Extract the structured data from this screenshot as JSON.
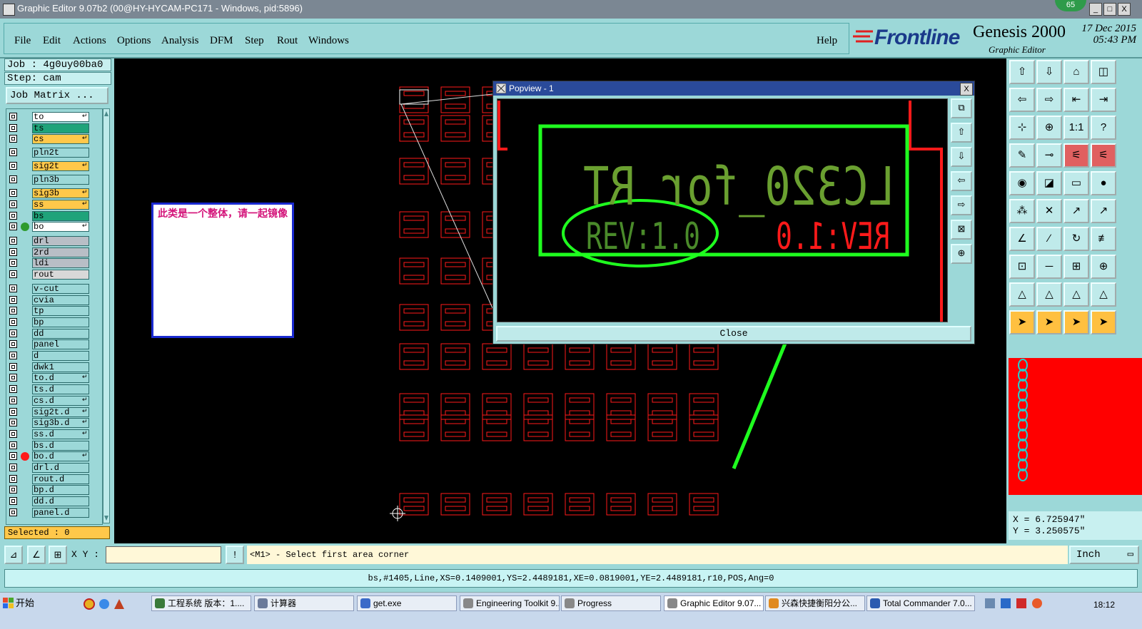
{
  "window": {
    "title": "Graphic Editor 9.07b2 (00@HY-HYCAM-PC171 - Windows, pid:5896)",
    "badge": "65",
    "minimize": "_",
    "maximize": "□",
    "close": "X"
  },
  "menu": {
    "items": [
      "File",
      "Edit",
      "Actions",
      "Options",
      "Analysis",
      "DFM",
      "Step",
      "Rout",
      "Windows"
    ],
    "help": "Help"
  },
  "brand": {
    "frontline": "Frontline",
    "product": "Genesis 2000",
    "subtitle": "Graphic Editor",
    "date": "17 Dec 2015",
    "time": "05:43 PM"
  },
  "job": {
    "job_label": "Job : 4g0uy00ba0",
    "step_label": "Step: cam",
    "job_matrix": "Job Matrix ...",
    "selected": "Selected : 0"
  },
  "layers": [
    {
      "name": "to",
      "color": "#ffffff",
      "flag": "↵"
    },
    {
      "name": "ts",
      "color": "#1fa37a",
      "flag": ""
    },
    {
      "name": "cs",
      "color": "#ffc84a",
      "flag": "↵"
    },
    {
      "name": "pln2t",
      "color": "#9cd8d8",
      "flag": ""
    },
    {
      "name": "sig2t",
      "color": "#ffc84a",
      "flag": "↵"
    },
    {
      "name": "pln3b",
      "color": "#9cd8d8",
      "flag": ""
    },
    {
      "name": "sig3b",
      "color": "#ffc84a",
      "flag": "↵"
    },
    {
      "name": "ss",
      "color": "#ffc84a",
      "flag": "↵"
    },
    {
      "name": "bs",
      "color": "#1fa37a",
      "flag": ""
    },
    {
      "name": "bo",
      "color": "#ffffff",
      "flag": "↵",
      "dot": "#2e9b2e"
    },
    {
      "name": "drl",
      "color": "#b8bec6",
      "flag": ""
    },
    {
      "name": "2rd",
      "color": "#b8bec6",
      "flag": ""
    },
    {
      "name": "ldi",
      "color": "#b8bec6",
      "flag": ""
    },
    {
      "name": "rout",
      "color": "#d8d8d8",
      "flag": ""
    },
    {
      "name": "v-cut",
      "color": "#9cd8d8",
      "flag": ""
    },
    {
      "name": "cvia",
      "color": "#9cd8d8",
      "flag": ""
    },
    {
      "name": "tp",
      "color": "#9cd8d8",
      "flag": ""
    },
    {
      "name": "bp",
      "color": "#9cd8d8",
      "flag": ""
    },
    {
      "name": "dd",
      "color": "#9cd8d8",
      "flag": ""
    },
    {
      "name": "panel",
      "color": "#9cd8d8",
      "flag": ""
    },
    {
      "name": "d",
      "color": "#9cd8d8",
      "flag": ""
    },
    {
      "name": "dwk1",
      "color": "#9cd8d8",
      "flag": ""
    },
    {
      "name": "to.d",
      "color": "#9cd8d8",
      "flag": "↵"
    },
    {
      "name": "ts.d",
      "color": "#9cd8d8",
      "flag": ""
    },
    {
      "name": "cs.d",
      "color": "#9cd8d8",
      "flag": "↵"
    },
    {
      "name": "sig2t.d",
      "color": "#9cd8d8",
      "flag": "↵"
    },
    {
      "name": "sig3b.d",
      "color": "#9cd8d8",
      "flag": "↵"
    },
    {
      "name": "ss.d",
      "color": "#9cd8d8",
      "flag": "↵"
    },
    {
      "name": "bs.d",
      "color": "#9cd8d8",
      "flag": ""
    },
    {
      "name": "bo.d",
      "color": "#9cd8d8",
      "flag": "↵",
      "dot": "#ff1a1a"
    },
    {
      "name": "drl.d",
      "color": "#9cd8d8",
      "flag": ""
    },
    {
      "name": "rout.d",
      "color": "#9cd8d8",
      "flag": ""
    },
    {
      "name": "bp.d",
      "color": "#9cd8d8",
      "flag": ""
    },
    {
      "name": "dd.d",
      "color": "#9cd8d8",
      "flag": ""
    },
    {
      "name": "panel.d",
      "color": "#9cd8d8",
      "flag": ""
    }
  ],
  "note": {
    "text": "此类是一个整体，请一起镜像"
  },
  "popview": {
    "title": "Popview - 1",
    "close_label": "Close",
    "line1": "LC320_for RT",
    "line2_left": "REV:1.0",
    "line2_right": "REV:1.0"
  },
  "coords": {
    "x": "X = 6.725947\"",
    "y": "Y = 3.250575\""
  },
  "command": {
    "xy_label": "X Y :",
    "xy_value": "",
    "alert": "!",
    "prompt": "<M1> - Select first area corner",
    "units": "Inch"
  },
  "status": {
    "text": "bs,#1405,Line,XS=0.1409001,YS=2.4489181,XE=0.0819001,YE=2.4489181,r10,POS,Ang=0"
  },
  "taskbar": {
    "start": "开始",
    "tasks": [
      {
        "label": "工程系统  版本：1....",
        "icon": "#3a7a3a"
      },
      {
        "label": "计算器",
        "icon": "#6a7a9a"
      },
      {
        "label": "get.exe",
        "icon": "#3a6ac8"
      },
      {
        "label": "Engineering Toolkit 9....",
        "icon": "#888888"
      },
      {
        "label": "Progress",
        "icon": "#888888"
      },
      {
        "label": "Graphic Editor 9.07...",
        "icon": "#888888",
        "active": true
      },
      {
        "label": "兴森快捷衡阳分公...",
        "icon": "#e08a20"
      },
      {
        "label": "Total Commander 7.0...",
        "icon": "#2a5ab0"
      }
    ],
    "clock": "18:12"
  },
  "icons": {
    "sysmenu": "window-menu-icon",
    "chrome": "chrome-icon",
    "ie": "ie-icon"
  },
  "colors": {
    "panel": "#9cd8d8",
    "pcb": "#ff1a1a",
    "highlight": "#1fff1f",
    "selected_bg": "#ffc84a"
  }
}
